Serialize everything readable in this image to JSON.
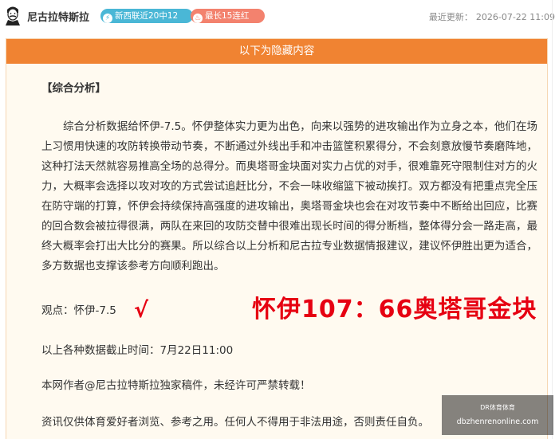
{
  "header": {
    "author_name": "尼古拉特斯拉",
    "badge_recent": "新西联近20中12",
    "badge_streak": "最长15连红",
    "updated_label": "最近更新：",
    "updated_time": "2026-07-22 11:09"
  },
  "card": {
    "banner": "以下为隐藏内容",
    "section_title": "【综合分析】",
    "analysis": "综合分析数据给怀伊-7.5。怀伊整体实力更为出色，向来以强势的进攻输出作为立身之本，他们在场上习惯用快速的攻防转换带动节奏，不断通过外线出手和冲击篮筐积累得分，不会刻意放慢节奏磨阵地，这种打法天然就容易推高全场的总得分。而奥塔哥金块面对实力占优的对手，很难靠死守限制住对方的火力，大概率会选择以攻对攻的方式尝试追赶比分，不会一味收缩篮下被动挨打。双方都没有把重点完全压在防守端的打算，怀伊会持续保持高强度的进攻输出，奥塔哥金块也会在对攻节奏中不断给出回应，比赛的回合数会被拉得很满，两队在来回的攻防交替中很难出现长时间的得分断档，整体得分会一路走高，最终大概率会打出大比分的赛果。所以综合以上分析和尼古拉专业数据情报建议，建议怀伊胜出更为适合，多方数据也支撑该参考方向顺利跑出。",
    "opinion": "观点：怀伊-7.5",
    "check_mark": "√",
    "result": "怀伊107：66奥塔哥金块",
    "cutoff": "以上各种数据截止时间：7月22日11:00",
    "copyright": "本网作者@尼古拉特斯拉独家稿件，未经许可严禁转载！",
    "disclaimer": "资讯仅供体育爱好者浏览、参考之用。任何人不得用于非法用途，否则责任自负。"
  },
  "watermark": {
    "line1": "DR体育体育",
    "line2": "dbzhenrenonline.com"
  },
  "colors": {
    "banner": "#f08332",
    "card_bg": "#fffaf0",
    "badge_blue": "#4ab7d6",
    "badge_red": "#f3826e",
    "result_red": "#e60012"
  },
  "icons": {
    "avatar": "tesla-portrait-avatar",
    "badge_recent_icon": "lightning-icon",
    "badge_streak_icon": "flame-icon"
  }
}
